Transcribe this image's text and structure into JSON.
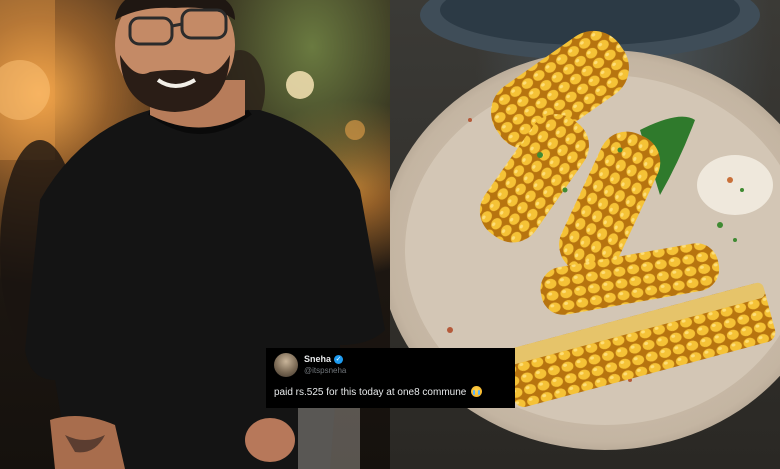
{
  "left_photo": {
    "subject": "smiling bearded man in black t-shirt",
    "setting": "restaurant with warm bokeh lights"
  },
  "right_photo": {
    "subject": "grilled corn cobs on a plate with dip"
  },
  "tweet": {
    "display_name": "Sneha",
    "handle": "@itspsneha",
    "text": "paid rs.525 for this today at one8 commune",
    "emoji_icon": "crying-face-icon",
    "verified_icon": "verified-badge-icon"
  },
  "colors": {
    "tweet_background": "#000000",
    "verified_blue": "#1d9bf0",
    "corn_yellow": "#f2b22a"
  }
}
